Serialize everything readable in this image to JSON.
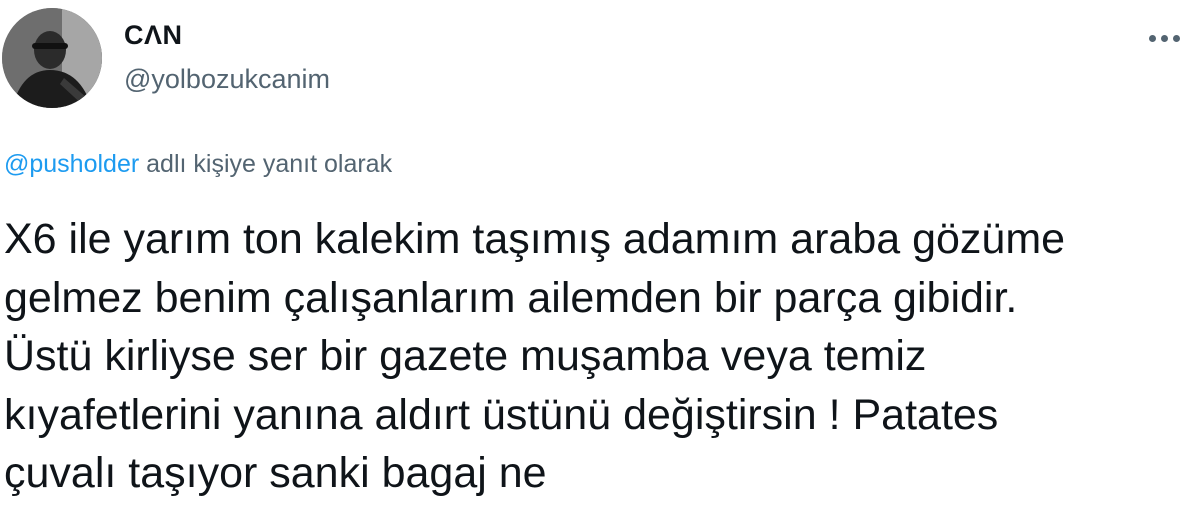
{
  "author": {
    "display_name": "CΛN",
    "handle": "@yolbozukcanim"
  },
  "reply": {
    "mention": "@pusholder",
    "suffix": " adlı kişiye yanıt olarak"
  },
  "tweet": {
    "lines": [
      "X6 ile yarım ton kalekim taşımış adamım araba gözüme",
      "gelmez benim çalışanlarım ailemden bir parça gibidir.",
      "Üstü kirliyse ser bir gazete muşamba veya temiz",
      "kıyafetlerini yanına aldırt üstünü değiştirsin ! Patates",
      "çuvalı taşıyor sanki bagaj ne"
    ]
  },
  "icons": {
    "more": "more-horizontal-icon",
    "avatar": "profile-photo"
  },
  "colors": {
    "text": "#0f1419",
    "secondary": "#536471",
    "link": "#1d9bf0",
    "background": "#ffffff"
  }
}
